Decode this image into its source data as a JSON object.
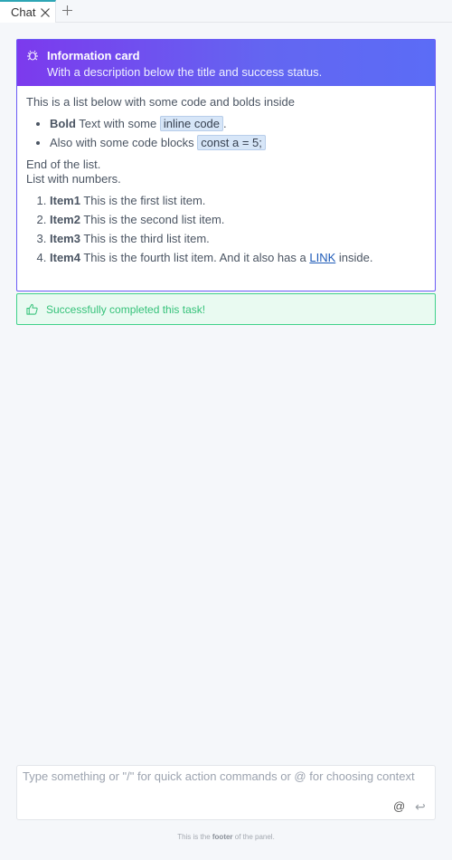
{
  "tabs": [
    {
      "label": "Chat",
      "active": true
    }
  ],
  "card": {
    "title": "Information card",
    "description": "With a description below the title and success status.",
    "intro": "This is a list below with some code and bolds inside",
    "bullets": [
      {
        "bold": "Bold",
        "text": " Text with some ",
        "code": "inline code",
        "after": "."
      },
      {
        "text": "Also with some code blocks ",
        "code": "const a = 5;"
      }
    ],
    "end_line1": "End of the list.",
    "end_line2": "List with numbers.",
    "numbered": [
      {
        "bold": "Item1",
        "text": " This is the first list item."
      },
      {
        "bold": "Item2",
        "text": " This is the second list item."
      },
      {
        "bold": "Item3",
        "text": " This is the third list item."
      },
      {
        "bold": "Item4",
        "text": " This is the fourth list item. And it also has a ",
        "link": "LINK",
        "after": " inside."
      }
    ]
  },
  "status": {
    "text": "Successfully completed this task!",
    "color": "#36c27a"
  },
  "input": {
    "placeholder": "Type something or \"/\" for quick action commands or @ for choosing context",
    "value": "",
    "at_label": "@",
    "enter_label": "↩"
  },
  "footer": {
    "before": "This is the ",
    "bold": "footer",
    "after": " of the panel."
  },
  "colors": {
    "accent": "#2ea6b5",
    "header_gradient_start": "#7c3aed",
    "header_gradient_end": "#5b6cf6",
    "success": "#3fd18a"
  }
}
